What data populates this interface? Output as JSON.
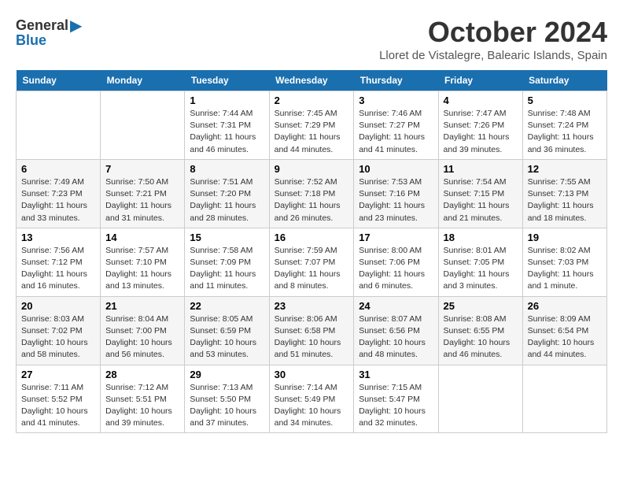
{
  "header": {
    "logo_general": "General",
    "logo_blue": "Blue",
    "month_title": "October 2024",
    "location": "Lloret de Vistalegre, Balearic Islands, Spain"
  },
  "days_of_week": [
    "Sunday",
    "Monday",
    "Tuesday",
    "Wednesday",
    "Thursday",
    "Friday",
    "Saturday"
  ],
  "weeks": [
    [
      {
        "day": "",
        "info": ""
      },
      {
        "day": "",
        "info": ""
      },
      {
        "day": "1",
        "info": "Sunrise: 7:44 AM\nSunset: 7:31 PM\nDaylight: 11 hours and 46 minutes."
      },
      {
        "day": "2",
        "info": "Sunrise: 7:45 AM\nSunset: 7:29 PM\nDaylight: 11 hours and 44 minutes."
      },
      {
        "day": "3",
        "info": "Sunrise: 7:46 AM\nSunset: 7:27 PM\nDaylight: 11 hours and 41 minutes."
      },
      {
        "day": "4",
        "info": "Sunrise: 7:47 AM\nSunset: 7:26 PM\nDaylight: 11 hours and 39 minutes."
      },
      {
        "day": "5",
        "info": "Sunrise: 7:48 AM\nSunset: 7:24 PM\nDaylight: 11 hours and 36 minutes."
      }
    ],
    [
      {
        "day": "6",
        "info": "Sunrise: 7:49 AM\nSunset: 7:23 PM\nDaylight: 11 hours and 33 minutes."
      },
      {
        "day": "7",
        "info": "Sunrise: 7:50 AM\nSunset: 7:21 PM\nDaylight: 11 hours and 31 minutes."
      },
      {
        "day": "8",
        "info": "Sunrise: 7:51 AM\nSunset: 7:20 PM\nDaylight: 11 hours and 28 minutes."
      },
      {
        "day": "9",
        "info": "Sunrise: 7:52 AM\nSunset: 7:18 PM\nDaylight: 11 hours and 26 minutes."
      },
      {
        "day": "10",
        "info": "Sunrise: 7:53 AM\nSunset: 7:16 PM\nDaylight: 11 hours and 23 minutes."
      },
      {
        "day": "11",
        "info": "Sunrise: 7:54 AM\nSunset: 7:15 PM\nDaylight: 11 hours and 21 minutes."
      },
      {
        "day": "12",
        "info": "Sunrise: 7:55 AM\nSunset: 7:13 PM\nDaylight: 11 hours and 18 minutes."
      }
    ],
    [
      {
        "day": "13",
        "info": "Sunrise: 7:56 AM\nSunset: 7:12 PM\nDaylight: 11 hours and 16 minutes."
      },
      {
        "day": "14",
        "info": "Sunrise: 7:57 AM\nSunset: 7:10 PM\nDaylight: 11 hours and 13 minutes."
      },
      {
        "day": "15",
        "info": "Sunrise: 7:58 AM\nSunset: 7:09 PM\nDaylight: 11 hours and 11 minutes."
      },
      {
        "day": "16",
        "info": "Sunrise: 7:59 AM\nSunset: 7:07 PM\nDaylight: 11 hours and 8 minutes."
      },
      {
        "day": "17",
        "info": "Sunrise: 8:00 AM\nSunset: 7:06 PM\nDaylight: 11 hours and 6 minutes."
      },
      {
        "day": "18",
        "info": "Sunrise: 8:01 AM\nSunset: 7:05 PM\nDaylight: 11 hours and 3 minutes."
      },
      {
        "day": "19",
        "info": "Sunrise: 8:02 AM\nSunset: 7:03 PM\nDaylight: 11 hours and 1 minute."
      }
    ],
    [
      {
        "day": "20",
        "info": "Sunrise: 8:03 AM\nSunset: 7:02 PM\nDaylight: 10 hours and 58 minutes."
      },
      {
        "day": "21",
        "info": "Sunrise: 8:04 AM\nSunset: 7:00 PM\nDaylight: 10 hours and 56 minutes."
      },
      {
        "day": "22",
        "info": "Sunrise: 8:05 AM\nSunset: 6:59 PM\nDaylight: 10 hours and 53 minutes."
      },
      {
        "day": "23",
        "info": "Sunrise: 8:06 AM\nSunset: 6:58 PM\nDaylight: 10 hours and 51 minutes."
      },
      {
        "day": "24",
        "info": "Sunrise: 8:07 AM\nSunset: 6:56 PM\nDaylight: 10 hours and 48 minutes."
      },
      {
        "day": "25",
        "info": "Sunrise: 8:08 AM\nSunset: 6:55 PM\nDaylight: 10 hours and 46 minutes."
      },
      {
        "day": "26",
        "info": "Sunrise: 8:09 AM\nSunset: 6:54 PM\nDaylight: 10 hours and 44 minutes."
      }
    ],
    [
      {
        "day": "27",
        "info": "Sunrise: 7:11 AM\nSunset: 5:52 PM\nDaylight: 10 hours and 41 minutes."
      },
      {
        "day": "28",
        "info": "Sunrise: 7:12 AM\nSunset: 5:51 PM\nDaylight: 10 hours and 39 minutes."
      },
      {
        "day": "29",
        "info": "Sunrise: 7:13 AM\nSunset: 5:50 PM\nDaylight: 10 hours and 37 minutes."
      },
      {
        "day": "30",
        "info": "Sunrise: 7:14 AM\nSunset: 5:49 PM\nDaylight: 10 hours and 34 minutes."
      },
      {
        "day": "31",
        "info": "Sunrise: 7:15 AM\nSunset: 5:47 PM\nDaylight: 10 hours and 32 minutes."
      },
      {
        "day": "",
        "info": ""
      },
      {
        "day": "",
        "info": ""
      }
    ]
  ]
}
